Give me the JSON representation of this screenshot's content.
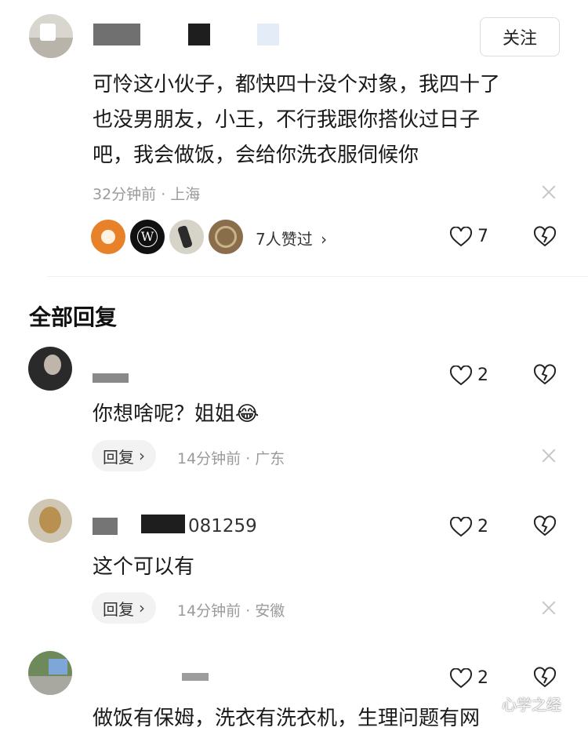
{
  "top_comment": {
    "follow_label": "关注",
    "text_lines": [
      "可怜这小伙子，都快四十没个对象，我四十了",
      "也没男朋友，小王，不行我跟你搭伙过日子",
      "吧，我会做饭，会给你洗衣服伺候你"
    ],
    "meta": "32分钟前 · 上海",
    "likers_label": "7人赞过",
    "like_count": "7"
  },
  "section_title": "全部回复",
  "replies": [
    {
      "username": "",
      "text": "你想啥呢？姐姐",
      "emoji": "😂",
      "reply_label": "回复",
      "meta": "14分钟前 · 广东",
      "like_count": "2"
    },
    {
      "username": "081259",
      "text": "这个可以有",
      "reply_label": "回复",
      "meta": "14分钟前 · 安徽",
      "like_count": "2"
    },
    {
      "username": "",
      "text": "做饭有保姆，洗衣有洗衣机，生理问题有网",
      "like_count": "2"
    }
  ],
  "watermark": "心学之经",
  "colors": {
    "accent_orange": "#e8822a",
    "divider": "#f0f0f0",
    "reply_bg": "#f2f2f2"
  },
  "icons": [
    "close-icon",
    "heart-icon",
    "broken-heart-icon",
    "chevron-right-icon"
  ]
}
